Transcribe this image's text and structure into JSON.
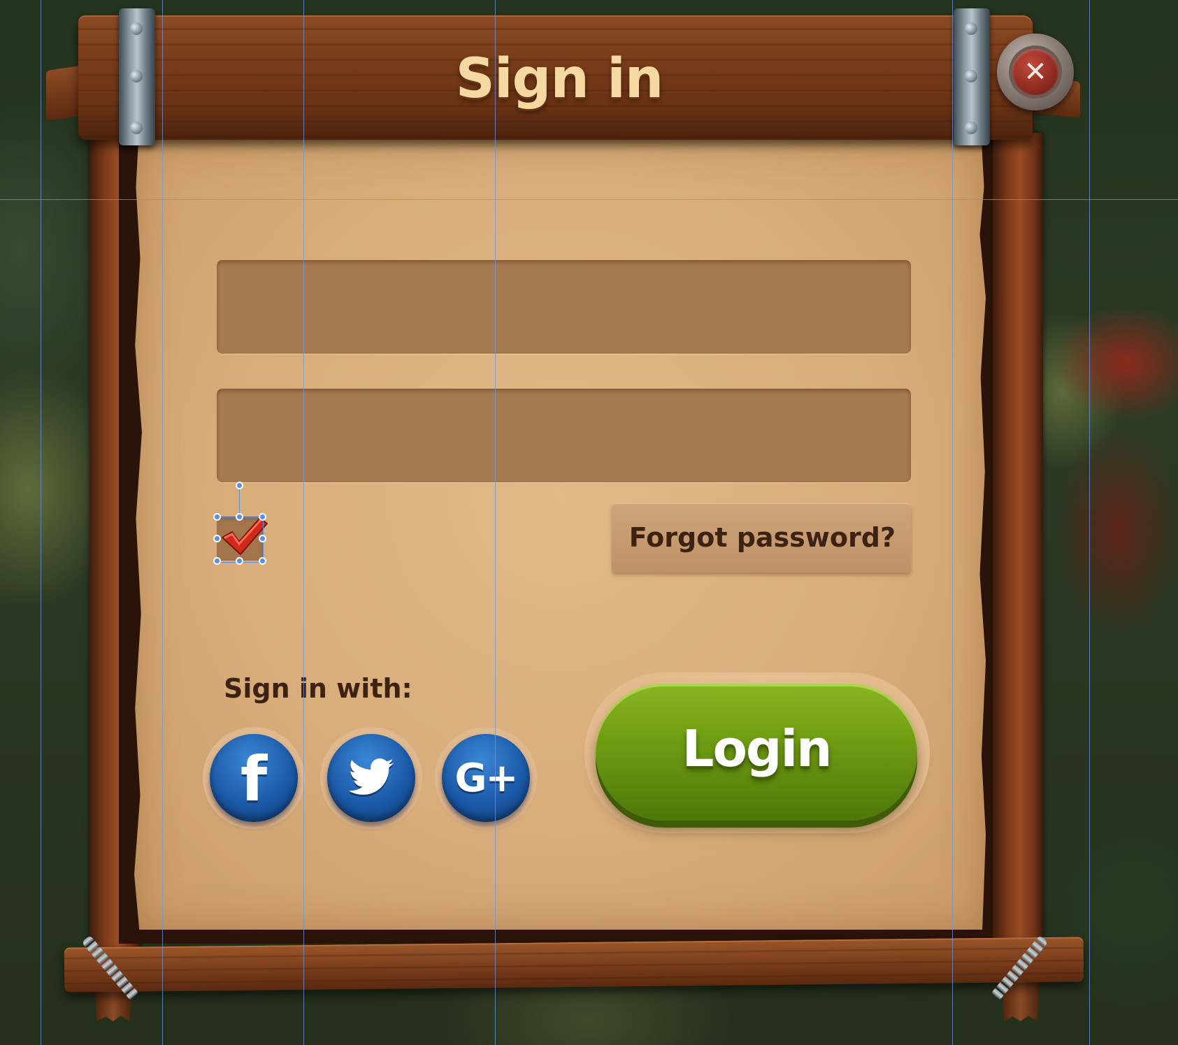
{
  "dialog": {
    "title": "Sign in",
    "close_icon": "close-icon",
    "close_glyph": "✕"
  },
  "form": {
    "username_value": "",
    "password_value": "",
    "remember_checked": true,
    "checkmark_icon": "checkmark-icon",
    "forgot_label": "Forgot password?",
    "login_label": "Login"
  },
  "social": {
    "heading": "Sign in with:",
    "providers": [
      {
        "name": "facebook",
        "icon": "facebook-icon",
        "glyph": "f"
      },
      {
        "name": "twitter",
        "icon": "twitter-bird-icon",
        "glyph": ""
      },
      {
        "name": "google-plus",
        "icon": "google-plus-icon",
        "glyph": "G+"
      }
    ]
  },
  "colors": {
    "title": "#f6d9a2",
    "parchment": "#d8ad7a",
    "field": "#a77b51",
    "login_green": "#6e9a12",
    "social_blue": "#1b5aa8",
    "close_red": "#8e2a21",
    "guide_blue": "#5b8fe6"
  }
}
